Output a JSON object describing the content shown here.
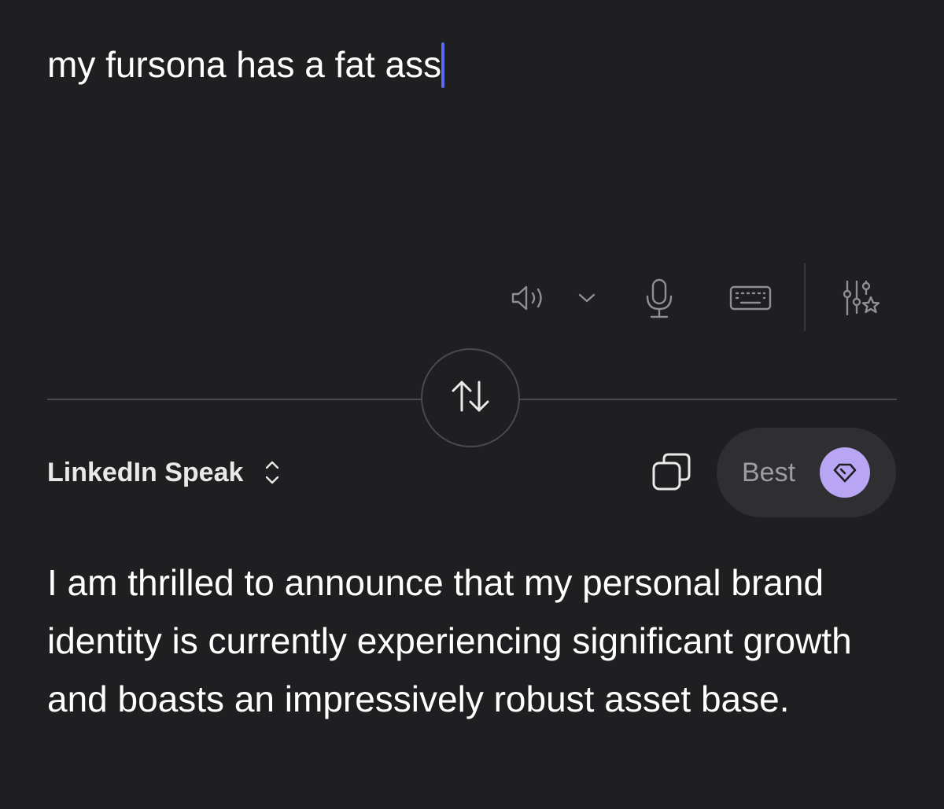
{
  "source": {
    "text": "my fursona has a fat ass"
  },
  "toolbar": {
    "icons": [
      "speaker-icon",
      "chevron-down-icon",
      "microphone-icon",
      "keyboard-icon",
      "sliders-star-icon"
    ]
  },
  "swap": {
    "icon": "swap-arrows-icon"
  },
  "mode": {
    "label": "LinkedIn Speak",
    "icon": "chevron-up-down-icon"
  },
  "actions": {
    "copy_icon": "copy-icon",
    "quality_label": "Best",
    "quality_icon": "gem-icon"
  },
  "output": {
    "text": "I am thrilled to announce that my personal brand identity is currently experiencing significant growth and boasts an impressively robust asset base."
  },
  "colors": {
    "background": "#1f1f21",
    "caret": "#5b6cf0",
    "pill": "#2f2f31",
    "gem_accent": "#b8a6f4",
    "icon_gray": "#8e8e93"
  }
}
